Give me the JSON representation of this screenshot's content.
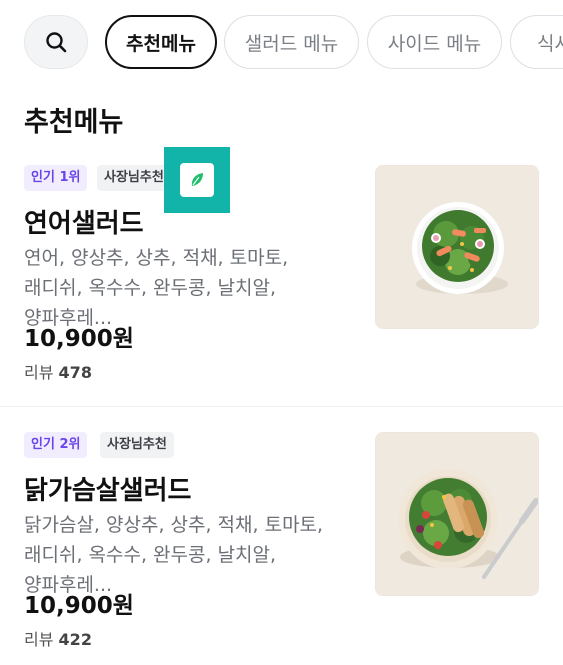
{
  "tabs": [
    {
      "label": "추천메뉴",
      "active": true
    },
    {
      "label": "샐러드 메뉴",
      "active": false
    },
    {
      "label": "사이드 메뉴",
      "active": false
    },
    {
      "label": "식사",
      "active": false
    }
  ],
  "section_title": "추천메뉴",
  "items": [
    {
      "rank_badge": "인기 1위",
      "owner_badge": "사장님추천",
      "eco_icon": "leaf-icon",
      "name": "연어샐러드",
      "description": "연어, 양상추, 상추, 적채, 토마토, 래디쉬, 옥수수, 완두콩, 날치알, 양파후레...",
      "price": "10,900원",
      "review_label": "리뷰",
      "review_count": "478",
      "image": "salmon-salad-bowl"
    },
    {
      "rank_badge": "인기 2위",
      "owner_badge": "사장님추천",
      "name": "닭가슴살샐러드",
      "description": "닭가슴살, 양상추, 상추, 적채, 토마토, 래디쉬, 옥수수, 완두콩, 날치알, 양파후레...",
      "price": "10,900원",
      "review_label": "리뷰",
      "review_count": "422",
      "image": "chicken-breast-salad-bowl"
    }
  ],
  "colors": {
    "rank_badge_bg": "#f1edff",
    "rank_badge_text": "#6a45e8",
    "eco_highlight": "#12b3a8",
    "leaf": "#1fbf6a"
  }
}
